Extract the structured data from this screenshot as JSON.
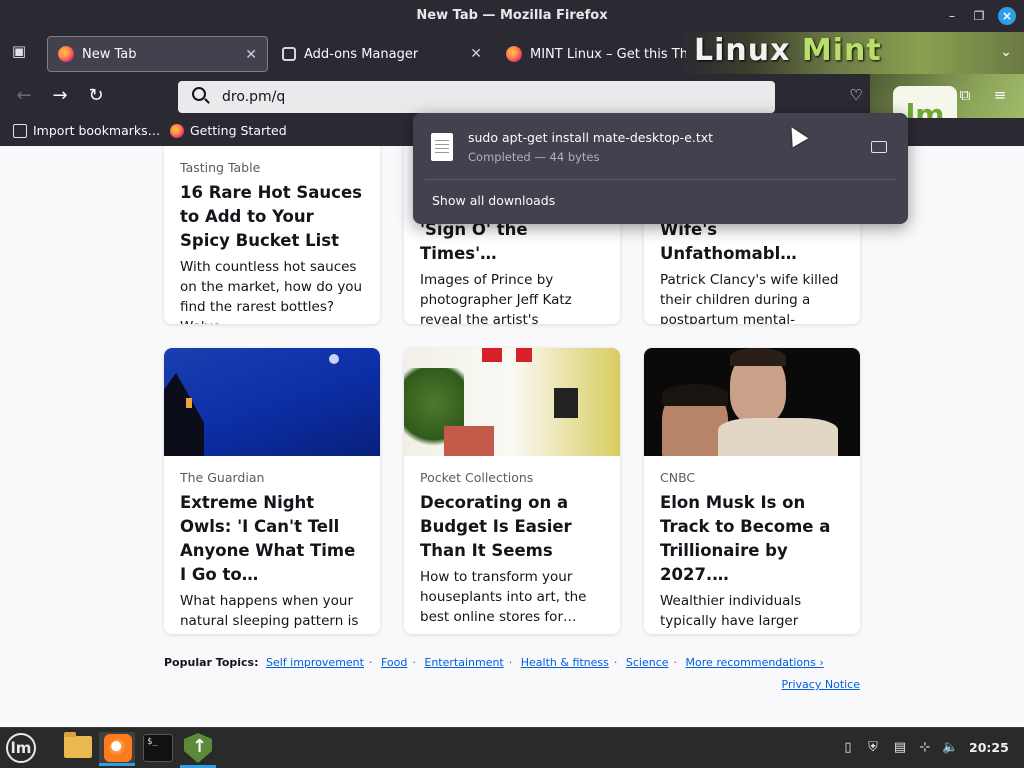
{
  "window": {
    "title": "New Tab — Mozilla Firefox"
  },
  "tabs": [
    {
      "label": "New Tab",
      "active": true
    },
    {
      "label": "Add-ons Manager",
      "active": false
    },
    {
      "label": "MINT Linux – Get this Theme",
      "active": false
    }
  ],
  "theme": {
    "brand_prefix": "Linux",
    "brand_suffix": "Mint"
  },
  "navbar": {
    "url": "dro.pm/q"
  },
  "bookmarks": [
    {
      "label": "Import bookmarks…"
    },
    {
      "label": "Getting Started"
    }
  ],
  "downloads": {
    "filename": "sudo apt-get install mate-desktop-e.txt",
    "status": "Completed — 44 bytes",
    "show_all": "Show all downloads"
  },
  "cards_top": [
    {
      "source": "Tasting Table",
      "headline": "16 Rare Hot Sauces to Add to Your Spicy Bucket List",
      "desc": "With countless hot sauces on the market, how do you find the rarest bottles? We've…"
    },
    {
      "source": "",
      "headline": "'Sign O' the Times'…",
      "desc": "Images of Prince by photographer Jeff Katz reveal the artist's endurin…"
    },
    {
      "source": "",
      "headline": "Wife's Unfathomabl…",
      "desc": "Patrick Clancy's wife killed their children during a postpartum mental-health…"
    }
  ],
  "cards_bottom": [
    {
      "source": "The Guardian",
      "headline": "Extreme Night Owls: 'I Can't Tell Anyone What Time I Go to…",
      "desc": "What happens when your natural sleeping pattern is at odds with the rest of the…"
    },
    {
      "source": "Pocket Collections",
      "headline": "Decorating on a Budget Is Easier Than It Seems",
      "desc": "How to transform your houseplants into art, the best online stores for…"
    },
    {
      "source": "CNBC",
      "headline": "Elon Musk Is on Track to Become a Trillionaire by 2027.…",
      "desc": "Wealthier individuals typically have larger portions of their assets in the stock…"
    }
  ],
  "popular": {
    "label": "Popular Topics:",
    "topics": [
      "Self improvement",
      "Food",
      "Entertainment",
      "Health & fitness",
      "Science",
      "More recommendations ›"
    ]
  },
  "privacy": "Privacy Notice",
  "taskbar": {
    "clock": "20:25"
  },
  "colors": {
    "accent": "#2e9ee8",
    "link": "#0060df",
    "chrome": "#2b2a33"
  }
}
